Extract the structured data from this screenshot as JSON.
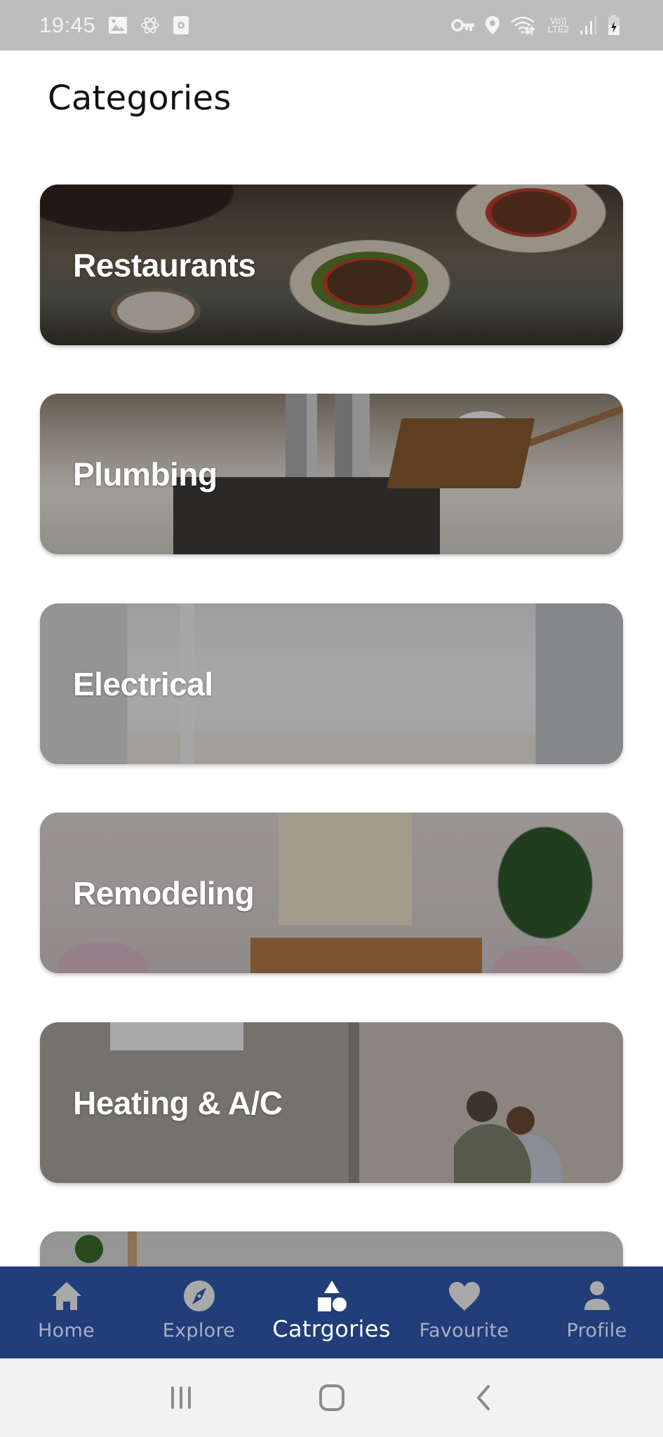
{
  "status_bar": {
    "time": "19:45",
    "left_icons": [
      "gallery-icon",
      "atom-icon",
      "app-notification-icon"
    ],
    "right_icons": [
      "vpn-key-icon",
      "location-icon",
      "wifi-icon",
      "volte-icon",
      "signal-icon",
      "battery-charging-icon"
    ],
    "volte_top": "Vo))",
    "volte_bottom": "LTE2"
  },
  "header": {
    "title": "Categories"
  },
  "categories": [
    {
      "label": "Restaurants"
    },
    {
      "label": "Plumbing"
    },
    {
      "label": "Electrical"
    },
    {
      "label": "Remodeling"
    },
    {
      "label": "Heating & A/C"
    },
    {
      "label": ""
    }
  ],
  "bottom_nav": {
    "active_index": 2,
    "items": [
      {
        "label": "Home",
        "icon": "home-icon"
      },
      {
        "label": "Explore",
        "icon": "compass-icon"
      },
      {
        "label": "Catrgories",
        "icon": "shapes-icon"
      },
      {
        "label": "Favourite",
        "icon": "heart-icon"
      },
      {
        "label": "Profile",
        "icon": "person-icon"
      }
    ]
  },
  "system_nav": {
    "buttons": [
      "recent-apps",
      "home",
      "back"
    ]
  },
  "colors": {
    "nav_background": "#213d7a",
    "nav_inactive": "#a9b0c2",
    "nav_active": "#ffffff",
    "status_bar": "#bdbdbd",
    "system_nav": "#f2f2f2"
  }
}
